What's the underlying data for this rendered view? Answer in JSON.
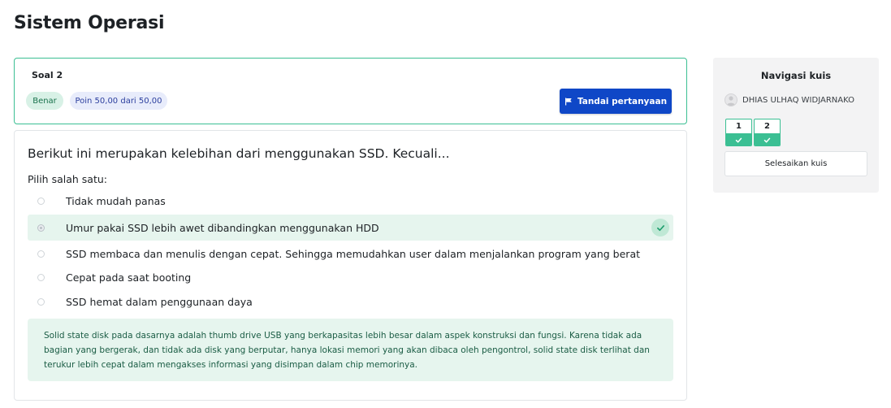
{
  "page": {
    "title": "Sistem Operasi"
  },
  "question_info": {
    "label": "Soal 2",
    "status": "Benar",
    "points": "Poin 50,00 dari 50,00",
    "flag_button": "Tandai pertanyaan"
  },
  "question": {
    "text": "Berikut ini merupakan kelebihan dari menggunakan SSD. Kecuali...",
    "prompt": "Pilih salah satu:",
    "options": [
      {
        "text": "Tidak mudah panas",
        "selected": false,
        "correct": false
      },
      {
        "text": "Umur pakai SSD lebih awet dibandingkan menggunakan HDD",
        "selected": true,
        "correct": true
      },
      {
        "text": "SSD membaca dan menulis dengan cepat. Sehingga memudahkan user dalam menjalankan program yang berat",
        "selected": false,
        "correct": false
      },
      {
        "text": "Cepat pada saat booting",
        "selected": false,
        "correct": false
      },
      {
        "text": "SSD hemat dalam penggunaan daya",
        "selected": false,
        "correct": false
      }
    ],
    "feedback": "Solid state disk pada dasarnya adalah thumb drive USB yang berkapasitas lebih besar dalam aspek konstruksi dan fungsi. Karena tidak ada bagian yang bergerak, dan tidak ada disk yang berputar, hanya lokasi memori yang akan dibaca oleh pengontrol, solid state disk terlihat dan terukur lebih cepat dalam mengakses informasi yang disimpan dalam chip memorinya."
  },
  "navigation": {
    "title": "Navigasi kuis",
    "user": "DHIAS ULHAQ WIDJARNAKO",
    "questions": [
      {
        "number": "1",
        "state": "correct"
      },
      {
        "number": "2",
        "state": "correct"
      }
    ],
    "finish_button": "Selesaikan kuis"
  },
  "colors": {
    "accent": "#0f47c7",
    "correct": "#3bbf93",
    "correct_bg": "#e6f5ee"
  },
  "icons": {
    "flag": "flag-icon",
    "check": "check-icon",
    "avatar": "user-avatar-icon"
  }
}
